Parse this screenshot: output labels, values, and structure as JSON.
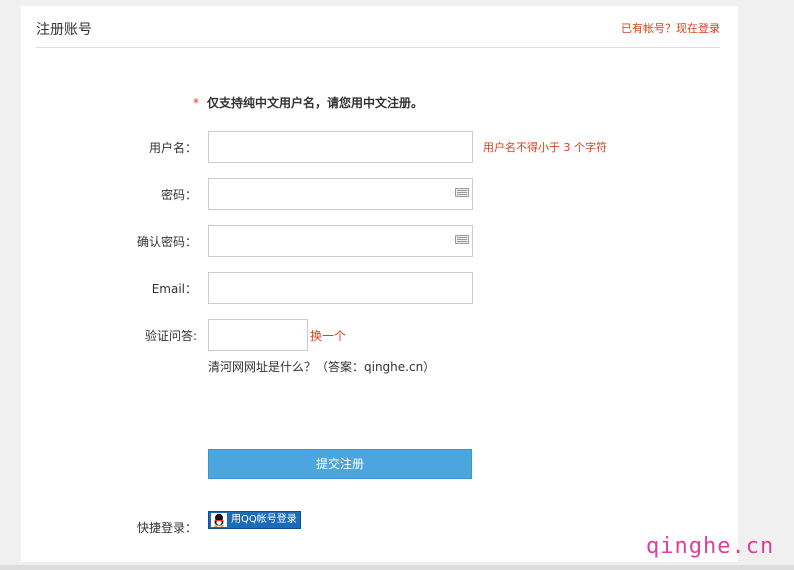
{
  "header": {
    "title": "注册账号",
    "login_link": "已有帐号？现在登录"
  },
  "notice": {
    "star": "*",
    "text": "仅支持纯中文用户名，请您用中文注册。"
  },
  "form": {
    "username_label": "用户名：",
    "username_value": "",
    "username_hint": "用户名不得小于 3 个字符",
    "password_label": "密码：",
    "password_value": "",
    "confirm_label": "确认密码：",
    "confirm_value": "",
    "email_label": "Email：",
    "email_value": "",
    "captcha_label": "验证问答:",
    "captcha_value": "",
    "captcha_refresh": "换一个",
    "captcha_question": "清河网网址是什么？（答案：qinghe.cn）",
    "submit_label": "提交注册"
  },
  "quick_login": {
    "label": "快捷登录：",
    "qq_button": "用QQ帐号登录"
  },
  "watermark": "qinghe.cn",
  "icons": {
    "keyboard": "keyboard-icon",
    "qq": "qq-penguin-icon"
  }
}
